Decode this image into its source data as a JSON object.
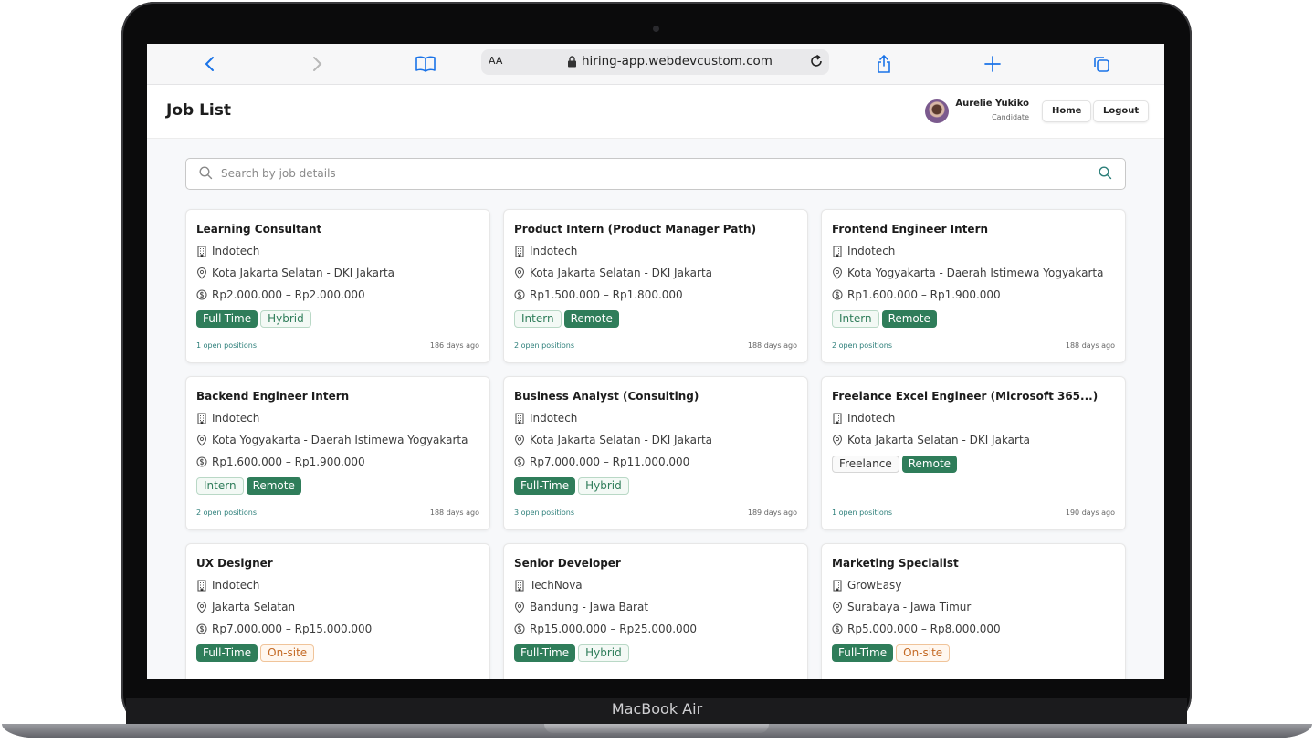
{
  "device": {
    "brand_label": "MacBook Air"
  },
  "browser": {
    "aa_label": "AA",
    "url": "hiring-app.webdevcustom.com"
  },
  "header": {
    "title": "Job List",
    "user_name": "Aurelie Yukiko",
    "user_role": "Candidate",
    "home_label": "Home",
    "logout_label": "Logout"
  },
  "search": {
    "placeholder": "Search by job details"
  },
  "colors": {
    "accent": "#2f7d5a",
    "onsite": "#c46a25",
    "link": "#2d7f7a"
  },
  "jobs": [
    {
      "title": "Learning Consultant",
      "company": "Indotech",
      "location": "Kota Jakarta Selatan - DKI Jakarta",
      "salary": "Rp2.000.000 – Rp2.000.000",
      "tags": [
        "Full-Time",
        "Hybrid"
      ],
      "positions": "1 open positions",
      "age": "186 days ago"
    },
    {
      "title": "Product Intern (Product Manager Path)",
      "company": "Indotech",
      "location": "Kota Jakarta Selatan - DKI Jakarta",
      "salary": "Rp1.500.000 – Rp1.800.000",
      "tags": [
        "Intern",
        "Remote"
      ],
      "positions": "2 open positions",
      "age": "188 days ago"
    },
    {
      "title": "Frontend Engineer Intern",
      "company": "Indotech",
      "location": "Kota Yogyakarta - Daerah Istimewa Yogyakarta",
      "salary": "Rp1.600.000 – Rp1.900.000",
      "tags": [
        "Intern",
        "Remote"
      ],
      "positions": "2 open positions",
      "age": "188 days ago"
    },
    {
      "title": "Backend Engineer Intern",
      "company": "Indotech",
      "location": "Kota Yogyakarta - Daerah Istimewa Yogyakarta",
      "salary": "Rp1.600.000 – Rp1.900.000",
      "tags": [
        "Intern",
        "Remote"
      ],
      "positions": "2 open positions",
      "age": "188 days ago"
    },
    {
      "title": "Business Analyst (Consulting)",
      "company": "Indotech",
      "location": "Kota Jakarta Selatan - DKI Jakarta",
      "salary": "Rp7.000.000 – Rp11.000.000",
      "tags": [
        "Full-Time",
        "Hybrid"
      ],
      "positions": "3 open positions",
      "age": "189 days ago"
    },
    {
      "title": "Freelance Excel Engineer (Microsoft 365...)",
      "company": "Indotech",
      "location": "Kota Jakarta Selatan - DKI Jakarta",
      "salary": "",
      "tags": [
        "Freelance",
        "Remote"
      ],
      "positions": "1 open positions",
      "age": "190 days ago"
    },
    {
      "title": "UX Designer",
      "company": "Indotech",
      "location": "Jakarta Selatan",
      "salary": "Rp7.000.000 – Rp15.000.000",
      "tags": [
        "Full-Time",
        "On-site"
      ],
      "positions": "",
      "age": ""
    },
    {
      "title": "Senior Developer",
      "company": "TechNova",
      "location": "Bandung - Jawa Barat",
      "salary": "Rp15.000.000 – Rp25.000.000",
      "tags": [
        "Full-Time",
        "Hybrid"
      ],
      "positions": "",
      "age": ""
    },
    {
      "title": "Marketing Specialist",
      "company": "GrowEasy",
      "location": "Surabaya - Jawa Timur",
      "salary": "Rp5.000.000 – Rp8.000.000",
      "tags": [
        "Full-Time",
        "On-site"
      ],
      "positions": "",
      "age": ""
    }
  ]
}
